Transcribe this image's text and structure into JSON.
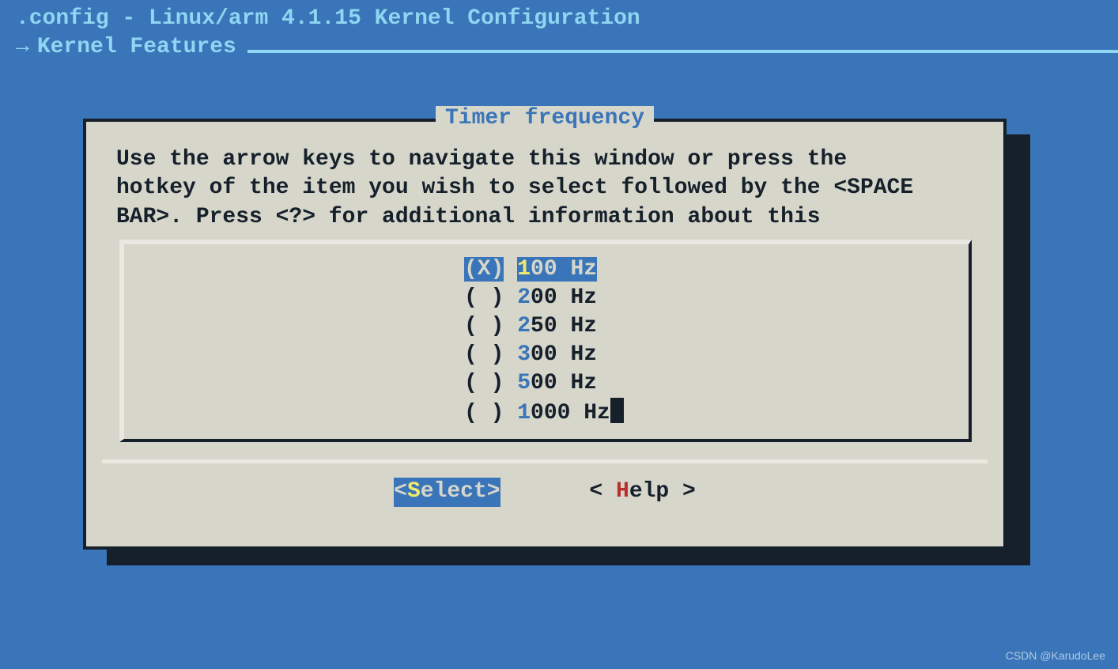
{
  "header": {
    "title": ".config - Linux/arm 4.1.15 Kernel Configuration",
    "breadcrumb_arrow": "→",
    "breadcrumb": "Kernel Features"
  },
  "dialog": {
    "title": "Timer frequency",
    "instructions": "Use the arrow keys to navigate this window or press the\nhotkey of the item you wish to select followed by the <SPACE\nBAR>. Press <?> for additional information about this",
    "options": [
      {
        "mark": "(X)",
        "hot": "1",
        "rest": "00 Hz",
        "selected": true
      },
      {
        "mark": "( )",
        "hot": "2",
        "rest": "00 Hz",
        "selected": false
      },
      {
        "mark": "( )",
        "hot": "2",
        "rest": "50 Hz",
        "selected": false
      },
      {
        "mark": "( )",
        "hot": "3",
        "rest": "00 Hz",
        "selected": false
      },
      {
        "mark": "( )",
        "hot": "5",
        "rest": "00 Hz",
        "selected": false
      },
      {
        "mark": "( )",
        "hot": "1",
        "rest": "000 Hz",
        "selected": false,
        "cursor": true
      }
    ],
    "buttons": {
      "select": {
        "open": "<",
        "hot": "S",
        "rest": "elect",
        "close": ">",
        "active": true
      },
      "help": {
        "open": "< ",
        "hot": "H",
        "rest": "elp",
        "close": " >",
        "active": false
      }
    }
  },
  "watermark": "CSDN @KarudoLee"
}
